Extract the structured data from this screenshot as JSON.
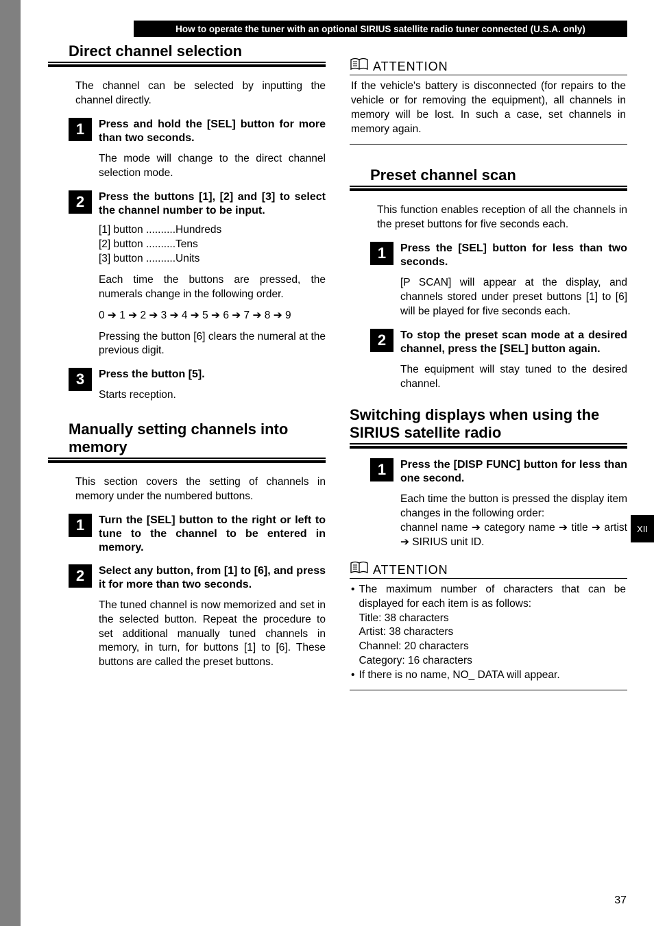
{
  "header": "How to operate the tuner with an optional SIRIUS satellite radio tuner connected (U.S.A. only)",
  "side_tab": "XII",
  "page_number": "37",
  "left": {
    "sec1": {
      "title": "Direct channel selection",
      "intro": "The channel can be selected by inputting the channel directly.",
      "step1": {
        "num": "1",
        "title": "Press and hold the [SEL] button for more than two seconds.",
        "desc": "The mode will change to the direct channel selection mode."
      },
      "step2": {
        "num": "2",
        "title": "Press the buttons [1], [2] and [3] to select the channel number to be input.",
        "lines": {
          "a": "[1] button ..........Hundreds",
          "b": "[2] button ..........Tens",
          "c": "[3] button ..........Units"
        },
        "para1": "Each time the buttons are pressed, the numerals change in the following order.",
        "seq": "0 ➔ 1 ➔ 2 ➔ 3 ➔ 4 ➔ 5 ➔ 6 ➔ 7 ➔ 8 ➔ 9",
        "para2": "Pressing the button [6] clears the numeral at the previous digit."
      },
      "step3": {
        "num": "3",
        "title": "Press the button [5].",
        "desc": "Starts reception."
      }
    },
    "sec2": {
      "title": "Manually setting channels into memory",
      "intro": "This section covers the setting of channels in memory under the numbered buttons.",
      "step1": {
        "num": "1",
        "title": "Turn the [SEL] button to the right or left to tune to the channel to be entered in memory."
      },
      "step2": {
        "num": "2",
        "title": "Select any button, from [1] to [6], and press it for more than two seconds.",
        "desc": "The tuned channel is now memorized and set in the selected button.  Repeat the procedure to set additional manually tuned channels in memory, in turn, for buttons [1] to [6].  These buttons are called the preset buttons."
      }
    }
  },
  "right": {
    "att1_label": "ATTENTION",
    "att1_body": "If the vehicle's battery is disconnected (for repairs to the vehicle or for removing the equipment), all channels in memory will be lost. In such a case, set channels in memory again.",
    "sec1": {
      "title": "Preset channel scan",
      "intro": "This function enables reception of all the channels in the preset buttons for five seconds each.",
      "step1": {
        "num": "1",
        "title": "Press the [SEL] button for less than two seconds.",
        "desc": "[P SCAN] will appear at the display, and channels stored under preset buttons [1] to [6] will be played for five seconds each."
      },
      "step2": {
        "num": "2",
        "title": "To stop the preset scan mode at a desired channel, press the [SEL] button again.",
        "desc": "The equipment will stay tuned to the desired channel."
      }
    },
    "sec2": {
      "title": "Switching displays when using the SIRIUS satellite radio",
      "step1": {
        "num": "1",
        "title": "Press the [DISP FUNC] button for less than one second.",
        "desc": "Each time the button is pressed the display item changes in the following order:",
        "desc2": "channel name ➔ category name ➔ title ➔ artist ➔ SIRIUS unit ID."
      }
    },
    "att2_label": "ATTENTION",
    "att2": {
      "b1": "The maximum number of characters that can be displayed for each item is as follows:",
      "b1a": "Title: 38 characters",
      "b1b": "Artist: 38 characters",
      "b1c": "Channel: 20 characters",
      "b1d": "Category: 16 characters",
      "b2": "If there is no name, NO_ DATA will appear."
    }
  }
}
